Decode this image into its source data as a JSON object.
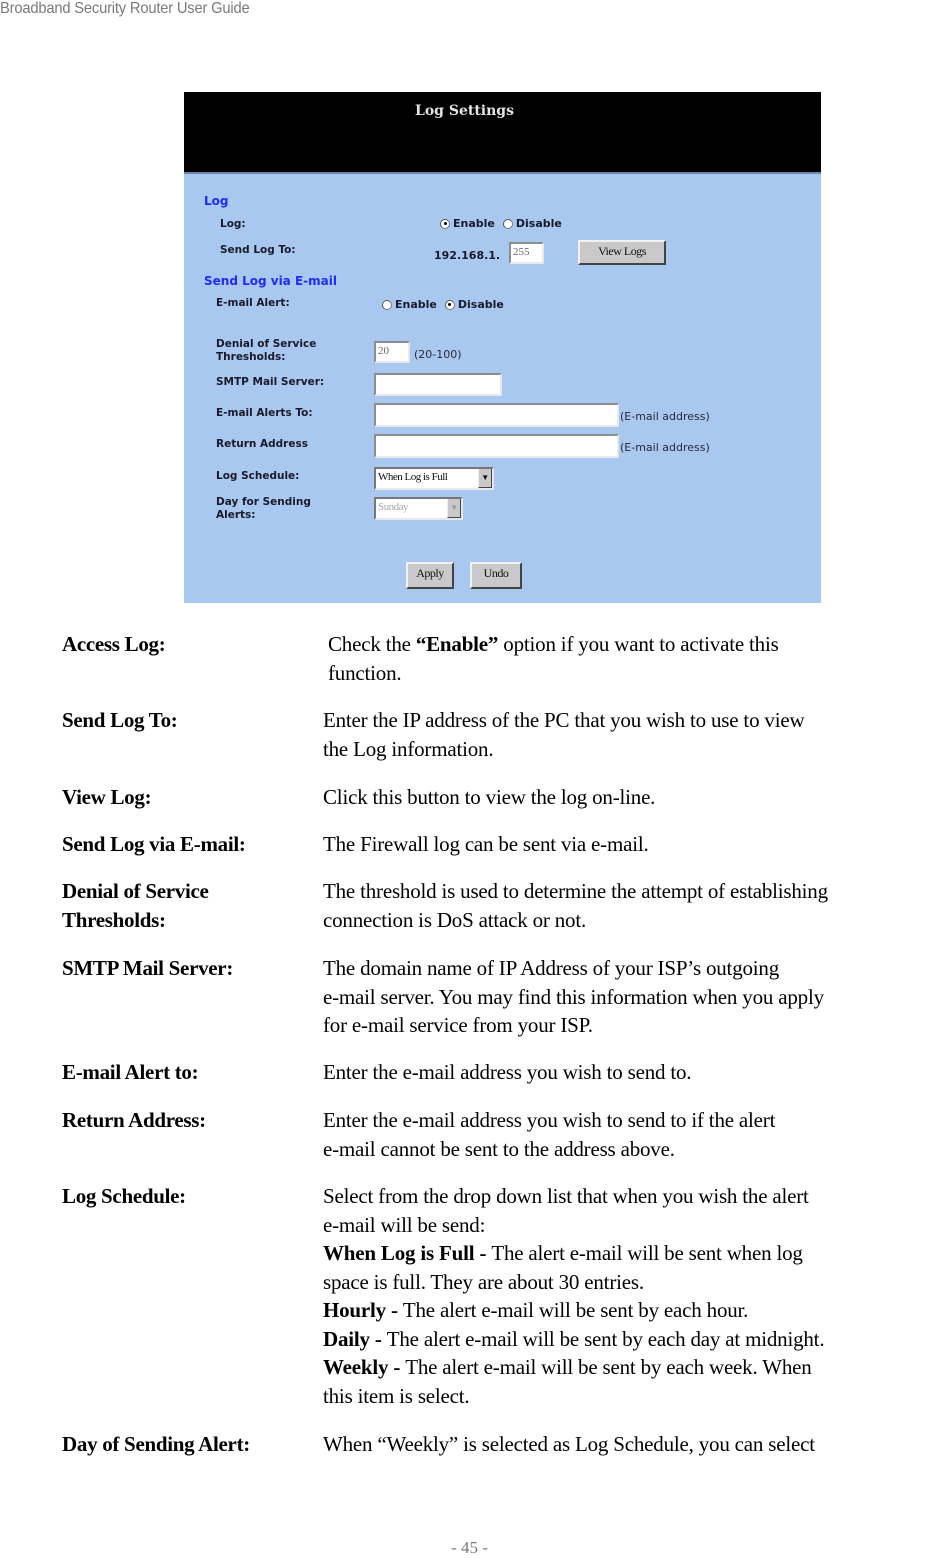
{
  "document": {
    "running_header": "Broadband Security Router User Guide",
    "page_number": "- 45 -"
  },
  "screenshot": {
    "title": "Log Settings",
    "colors": {
      "header_bg": "#000000",
      "panel_bg": "#a8c8ef",
      "section_heading": "#1f2cf5"
    },
    "log_section": {
      "heading": "Log",
      "log_label": "Log:",
      "log_options": [
        {
          "label": "Enable",
          "selected": true
        },
        {
          "label": "Disable",
          "selected": false
        }
      ],
      "send_log_to_label": "Send Log To:",
      "ip_prefix": "192.168.1.",
      "ip_last_octet": "255",
      "view_logs_button": "View Logs"
    },
    "email_section": {
      "heading": "Send Log via E-mail",
      "email_alert_label": "E-mail Alert:",
      "email_alert_options": [
        {
          "label": "Enable",
          "selected": false
        },
        {
          "label": "Disable",
          "selected": true
        }
      ],
      "dos_label_line1": "Denial of Service",
      "dos_label_line2": "Thresholds:",
      "dos_value": "20",
      "dos_hint": "(20-100)",
      "smtp_label": "SMTP Mail Server:",
      "smtp_value": "",
      "alerts_to_label": "E-mail Alerts To:",
      "alerts_to_value": "",
      "alerts_to_hint": "(E-mail address)",
      "return_label": "Return Address",
      "return_value": "",
      "return_hint": "(E-mail address)",
      "schedule_label": "Log Schedule:",
      "schedule_selected": "When Log is Full",
      "day_label_line1": "Day for Sending",
      "day_label_line2": "Alerts:",
      "day_selected": "Sunday",
      "day_disabled": true
    },
    "buttons": {
      "apply": "Apply",
      "undo": "Undo"
    }
  },
  "descriptions": [
    {
      "term": "Access Log:",
      "lines": [
        {
          "segments": [
            {
              "text": "Check the ",
              "bold": false
            },
            {
              "text": "“Enable”",
              "bold": true
            },
            {
              "text": " option if you want to activate this",
              "bold": false
            }
          ]
        },
        {
          "segments": [
            {
              "text": "function.",
              "bold": false
            }
          ]
        }
      ]
    },
    {
      "term": "Send Log To:",
      "lines": [
        {
          "segments": [
            {
              "text": "Enter the IP address of the PC that you wish to use to view",
              "bold": false
            }
          ]
        },
        {
          "segments": [
            {
              "text": "the Log information.",
              "bold": false
            }
          ]
        }
      ]
    },
    {
      "term": "View Log:",
      "lines": [
        {
          "segments": [
            {
              "text": "Click this button to view the log on-line.",
              "bold": false
            }
          ]
        }
      ]
    },
    {
      "term": "Send Log via E-mail:",
      "lines": [
        {
          "segments": [
            {
              "text": "The Firewall log can be sent via e-mail.",
              "bold": false
            }
          ]
        }
      ]
    },
    {
      "term": "Denial of Service Thresholds:",
      "term_lines": [
        "Denial of Service",
        "Thresholds:"
      ],
      "lines": [
        {
          "segments": [
            {
              "text": "The threshold is used to determine the attempt of establishing",
              "bold": false
            }
          ]
        },
        {
          "segments": [
            {
              "text": "connection is DoS attack or not.",
              "bold": false
            }
          ]
        }
      ]
    },
    {
      "term": "SMTP Mail Server:",
      "lines": [
        {
          "segments": [
            {
              "text": "The domain name of IP Address of your ISP’s outgoing",
              "bold": false
            }
          ]
        },
        {
          "segments": [
            {
              "text": "e-mail server. You may find this information when you apply",
              "bold": false
            }
          ]
        },
        {
          "segments": [
            {
              "text": "for e-mail service from your ISP.",
              "bold": false
            }
          ]
        }
      ]
    },
    {
      "term": "E-mail Alert to:",
      "lines": [
        {
          "segments": [
            {
              "text": "Enter the e-mail address you wish to send to.",
              "bold": false
            }
          ]
        }
      ]
    },
    {
      "term": "Return Address:",
      "lines": [
        {
          "segments": [
            {
              "text": "Enter the e-mail address you wish to send to if the alert",
              "bold": false
            }
          ]
        },
        {
          "segments": [
            {
              "text": "e-mail cannot be sent to the address above.",
              "bold": false
            }
          ]
        }
      ]
    },
    {
      "term": "Log Schedule:",
      "lines": [
        {
          "segments": [
            {
              "text": "Select from the drop down list that when you wish the alert",
              "bold": false
            }
          ]
        },
        {
          "segments": [
            {
              "text": "e-mail will be send:",
              "bold": false
            }
          ]
        },
        {
          "segments": [
            {
              "text": "When Log is Full - ",
              "bold": true
            },
            {
              "text": "The alert e-mail will be sent when log",
              "bold": false
            }
          ]
        },
        {
          "segments": [
            {
              "text": "space is full. They are about 30 entries.",
              "bold": false
            }
          ]
        },
        {
          "segments": [
            {
              "text": "Hourly - ",
              "bold": true
            },
            {
              "text": "The alert e-mail will be sent by each hour.",
              "bold": false
            }
          ]
        },
        {
          "segments": [
            {
              "text": "Daily - ",
              "bold": true
            },
            {
              "text": "The alert e-mail will be sent by each day at midnight.",
              "bold": false
            }
          ]
        },
        {
          "segments": [
            {
              "text": "Weekly - ",
              "bold": true
            },
            {
              "text": "The alert e-mail will be sent by each week. When",
              "bold": false
            }
          ]
        },
        {
          "segments": [
            {
              "text": "this item is select.",
              "bold": false
            }
          ]
        }
      ]
    },
    {
      "term": "Day of Sending Alert:",
      "lines": [
        {
          "segments": [
            {
              "text": "When “Weekly” is selected as Log Schedule, you can select",
              "bold": false
            }
          ]
        }
      ]
    }
  ]
}
